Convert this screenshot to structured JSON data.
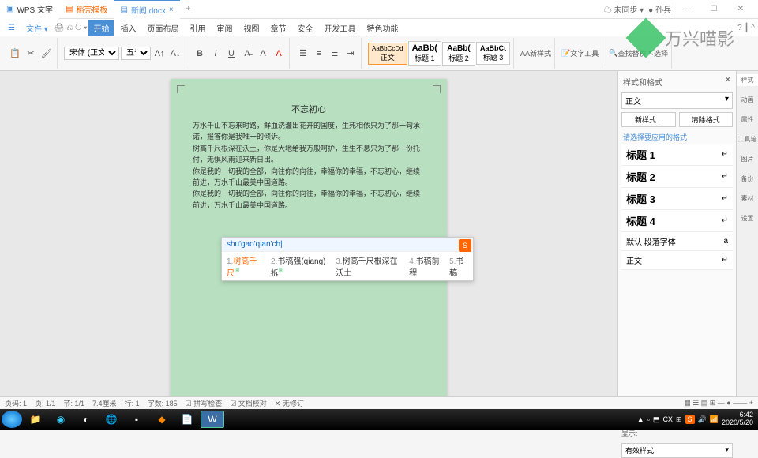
{
  "titlebar": {
    "app": "WPS 文字",
    "tab1": "稻壳模板",
    "tab2": "新闻.docx",
    "sync": "未同步",
    "user": "孙兵"
  },
  "menu": {
    "file": "文件",
    "items": [
      "开始",
      "插入",
      "页面布局",
      "引用",
      "审阅",
      "视图",
      "章节",
      "安全",
      "开发工具",
      "特色功能"
    ]
  },
  "toolbar": {
    "font": "宋体 (正文)",
    "size": "五号",
    "styles": {
      "s1": "AaBbCcDd",
      "s2": "AaBb(",
      "s3": "AaBb(",
      "s4": "AaBbCt",
      "l1": "正文",
      "l2": "标题 1",
      "l3": "标题 2",
      "l4": "标题 3",
      "new": "新样式",
      "text_tools": "文字工具",
      "find": "查找替换",
      "select": "选择"
    }
  },
  "doc": {
    "title": "不忘初心",
    "p1": "万水千山不忘来时路，鲜血浇灌出花开的国度，生死相依只为了那一句承诺，报答你是我唯一的倾诉。",
    "p2": "树高千尺根深在沃土，你是大地给我万般呵护，生生不息只为了那一份托付，无惧风雨迎来新日出。",
    "p3": "你是我的一切我的全部，向往你的向往，幸福你的幸福，不忘初心，继续前进，万水千山最美中国道路。",
    "p4": "你是我的一切我的全部，向往你的向往，幸福你的幸福，不忘初心，继续前进，万水千山最美中国道路。"
  },
  "ime": {
    "input": "shu'gao'qian'ch",
    "cands": [
      {
        "n": "1.",
        "t": "树高千尺"
      },
      {
        "n": "2.",
        "t": "书稿强(qiang)拆"
      },
      {
        "n": "3.",
        "t": "树高千尺根深在沃土"
      },
      {
        "n": "4.",
        "t": "书稿前程"
      },
      {
        "n": "5.",
        "t": "书稿"
      }
    ]
  },
  "panel": {
    "title": "样式和格式",
    "current": "正文",
    "new_btn": "新样式...",
    "clear_btn": "清除格式",
    "hint": "请选择要应用的格式",
    "styles": [
      "标题 1",
      "标题 2",
      "标题 3",
      "标题 4"
    ],
    "default": "默认 段落字体",
    "body": "正文",
    "show_label": "显示:",
    "show_val": "有效样式"
  },
  "sidetabs": [
    "样式",
    "动画",
    "属性",
    "工具箱",
    "图片",
    "备份",
    "素材",
    "设置"
  ],
  "status": {
    "page": "页码: 1",
    "pages": "页: 1/1",
    "sec": "节: 1/1",
    "pos": "7.4厘米",
    "line": "行: 1",
    "col": "字数: 185",
    "spell": "拼写检查",
    "doc_check": "文档校对",
    "no_fix": "无修订"
  },
  "tray": {
    "time": "6:42",
    "date": "2020/5/20"
  },
  "watermark": "万兴喵影"
}
